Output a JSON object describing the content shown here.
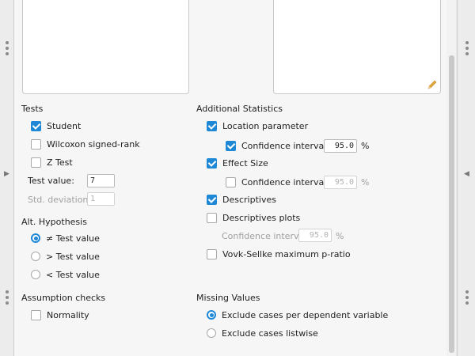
{
  "tests": {
    "title": "Tests",
    "student": {
      "label": "Student",
      "checked": true
    },
    "wilcoxon": {
      "label": "Wilcoxon signed-rank",
      "checked": false
    },
    "z_test": {
      "label": "Z Test",
      "checked": false
    },
    "test_value": {
      "label": "Test value:",
      "value": "7"
    },
    "std_deviation": {
      "label": "Std. deviation:",
      "value": "1"
    }
  },
  "alt_hypothesis": {
    "title": "Alt. Hypothesis",
    "options": [
      {
        "label": "≠ Test value",
        "selected": true
      },
      {
        "label": "> Test value",
        "selected": false
      },
      {
        "label": "< Test value",
        "selected": false
      }
    ]
  },
  "assumption_checks": {
    "title": "Assumption checks",
    "normality": {
      "label": "Normality",
      "checked": false
    }
  },
  "additional_statistics": {
    "title": "Additional Statistics",
    "location_parameter": {
      "label": "Location parameter",
      "checked": true
    },
    "location_ci": {
      "label": "Confidence interval",
      "checked": true,
      "value": "95.0",
      "shown_value": "95.0",
      "unit": "%"
    },
    "effect_size": {
      "label": "Effect Size",
      "checked": true
    },
    "effect_ci": {
      "label": "Confidence interval",
      "checked": false,
      "value": "95.0",
      "unit": "%"
    },
    "descriptives": {
      "label": "Descriptives",
      "checked": true
    },
    "descriptives_plots": {
      "label": "Descriptives plots",
      "checked": false
    },
    "plots_ci": {
      "label": "Confidence interval",
      "value": "95.0",
      "unit": "%"
    },
    "vovk_sellke": {
      "label": "Vovk-Sellke maximum p-ratio",
      "checked": false
    }
  },
  "missing_values": {
    "title": "Missing Values",
    "options": [
      {
        "label": "Exclude cases per dependent variable",
        "selected": true
      },
      {
        "label": "Exclude cases listwise",
        "selected": false
      }
    ]
  },
  "colors": {
    "accent": "#1e88d6",
    "panel": "#f6f6f6",
    "pencil": "#e2a93b"
  },
  "icons": {
    "left_handle": "drag-handle-dots",
    "left_arrow": "triangle-right",
    "right_arrow": "triangle-left",
    "edit": "pencil"
  }
}
